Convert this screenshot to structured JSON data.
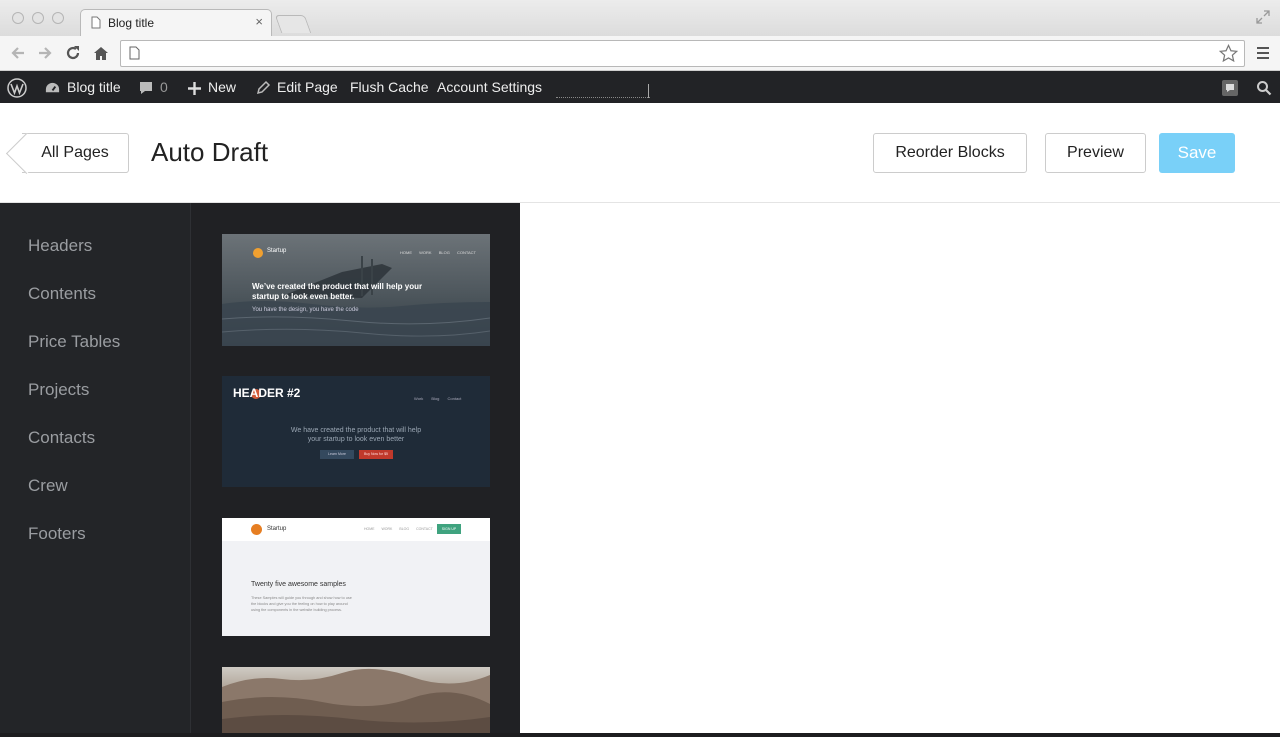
{
  "browser": {
    "tab_title": "Blog title",
    "tab_close": "×",
    "url": ""
  },
  "adminbar": {
    "site_name": "Blog title",
    "comments_count": "0",
    "new_label": "New",
    "edit_page_label": "Edit Page",
    "flush_cache_label": "Flush Cache",
    "account_settings_label": "Account Settings"
  },
  "editor": {
    "back_label": "All Pages",
    "page_title": "Auto Draft",
    "reorder_label": "Reorder Blocks",
    "preview_label": "Preview",
    "save_label": "Save",
    "save_color": "#79d0f8"
  },
  "sidebar": {
    "items": [
      {
        "label": "Headers"
      },
      {
        "label": "Contents"
      },
      {
        "label": "Price Tables"
      },
      {
        "label": "Projects"
      },
      {
        "label": "Contacts"
      },
      {
        "label": "Crew"
      },
      {
        "label": "Footers"
      }
    ]
  },
  "thumbnails": {
    "t1": {
      "brand": "Startup",
      "nav": [
        "HOME",
        "WORK",
        "BLOG",
        "CONTACT"
      ],
      "headline1": "We’ve created the product that will help your",
      "headline2": "startup to look even better.",
      "sub": "You have the design, you have the code"
    },
    "t2": {
      "label": "HEADER #2",
      "nav": [
        "Work",
        "Blog",
        "Contact"
      ],
      "headline1": "We have created the product that will help",
      "headline2": "your startup to look even better",
      "btn1": "Learn More",
      "btn2": "Buy Now for $5"
    },
    "t3": {
      "brand": "Startup",
      "nav": [
        "HOME",
        "WORK",
        "BLOG",
        "CONTACT"
      ],
      "signup": "SIGN UP",
      "heading": "Twenty five awesome samples",
      "body1": "These Samples will guide you through and show how to use",
      "body2": "the blocks and give you the feeling on how to play around",
      "body3": "using the components in the website building process."
    }
  }
}
